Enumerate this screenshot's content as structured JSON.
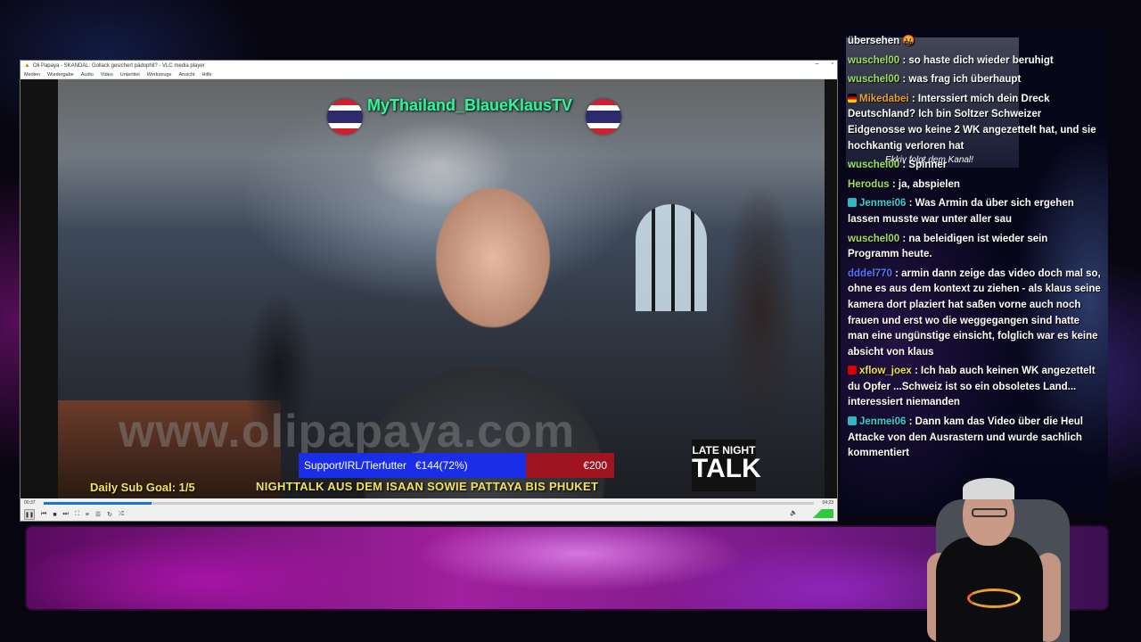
{
  "vlc": {
    "title": "Oli Papaya - SKANDAL: Gollack gesichert pädophil? - VLC media player",
    "menu": [
      "Medien",
      "Wiedergabe",
      "Audio",
      "Video",
      "Untertitel",
      "Werkzeuge",
      "Ansicht",
      "Hilfe"
    ],
    "time_elapsed": "00:37",
    "time_total": "04:23",
    "progress": 0.14,
    "volume": 1.0
  },
  "video": {
    "channel_name": "MyThailand_BlaueKlausTV",
    "watermark": "www.olipapaya.com",
    "goal": {
      "label": "Support/IRL/Tierfutter",
      "progress_text": "€144(72%)",
      "target": "€200",
      "fraction": 0.72
    },
    "daily_sub_goal": "Daily Sub Goal: 1/5",
    "ticker": "NIGHTTALK AUS DEM ISAAN SOWIE PATTAYA BIS PHUKET",
    "logo": {
      "line1": "LATE NIGHT",
      "line2": "TALK"
    }
  },
  "chat": {
    "follow_banner": "Ekkiv folgt dem Kanal!",
    "messages": [
      {
        "user": "",
        "user_color": "#ffffff",
        "badge": "",
        "text": "übersehen 🤬"
      },
      {
        "user": "wuschel00",
        "user_color": "#9fe060",
        "badge": "",
        "text": ": so haste dich wieder beruhigt"
      },
      {
        "user": "wuschel00",
        "user_color": "#9fe060",
        "badge": "",
        "text": ": was frag ich überhaupt"
      },
      {
        "user": "Mikedabei",
        "user_color": "#e8a030",
        "badge": "flag-de",
        "text": ": Interssiert mich dein Dreck Deutschland? Ich bin Soltzer Schweizer Eidgenosse wo keine 2 WK angezettelt hat, und sie hochkantig verloren hat"
      },
      {
        "user": "wuschel00",
        "user_color": "#9fe060",
        "badge": "",
        "text": ": Spinner"
      },
      {
        "user": "Herodus",
        "user_color": "#9fe060",
        "badge": "",
        "text": ": ja, abspielen"
      },
      {
        "user": "Jenmei06",
        "user_color": "#3ad0d0",
        "badge": "sub",
        "text": ": Was Armin da über sich ergehen lassen musste war unter aller sau"
      },
      {
        "user": "wuschel00",
        "user_color": "#9fe060",
        "badge": "",
        "text": ": na beleidigen ist wieder sein Programm heute."
      },
      {
        "user": "dddel770",
        "user_color": "#5577ff",
        "badge": "",
        "text": ": armin dann zeige das video doch mal so, ohne es aus dem kontext zu ziehen - als klaus seine kamera dort plaziert hat saßen vorne auch noch frauen und erst wo die weggegangen sind hatte man eine ungünstige einsicht, folglich war es keine absicht von klaus"
      },
      {
        "user": "xflow_joex",
        "user_color": "#f0e040",
        "badge": "flag-ch",
        "text": ": Ich hab auch keinen WK angezettelt du Opfer ...Schweiz ist so ein obsoletes Land... interessiert niemanden"
      },
      {
        "user": "Jenmei06",
        "user_color": "#3ad0d0",
        "badge": "sub",
        "text": ": Dann kam das Video über die Heul Attacke von den Ausrastern und wurde sachlich kommentiert"
      }
    ]
  },
  "colors": {
    "channel_name": "#3af09a",
    "goal_fill": "#1a2ee8",
    "goal_remaining": "#a01420",
    "ticker": "#f2e25a"
  }
}
